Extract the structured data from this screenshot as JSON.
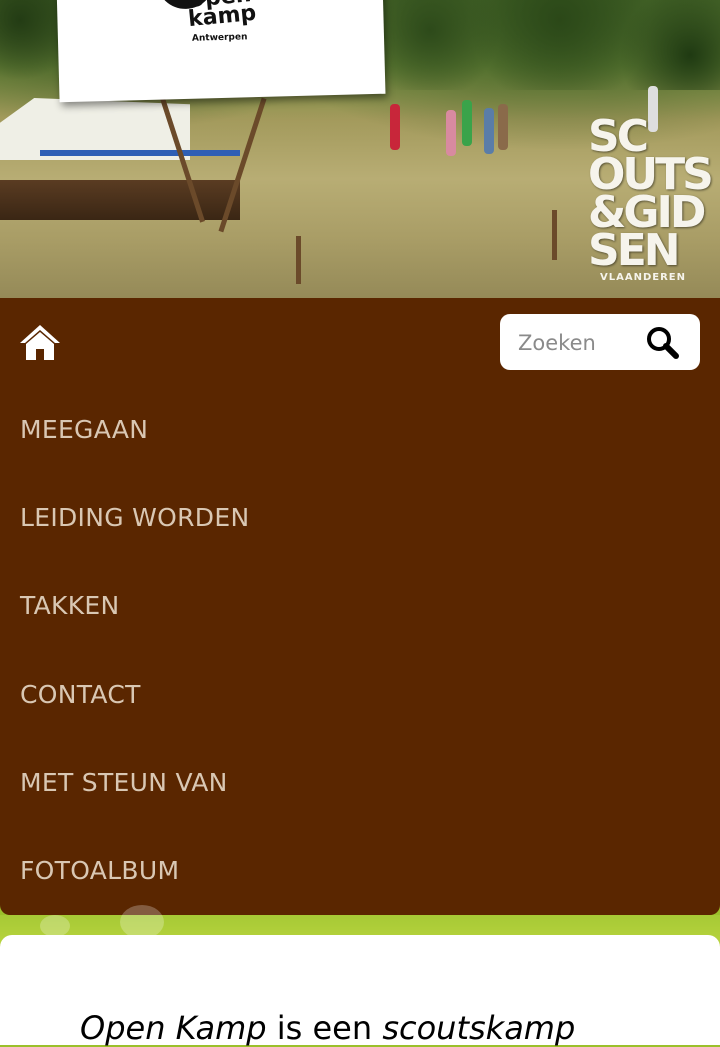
{
  "header": {
    "logo_line1": "Open",
    "logo_line2": "kamp",
    "logo_sub": "Antwerpen",
    "scouts_logo_lines": [
      "SC",
      "OUTS",
      "&GID",
      "SEN"
    ],
    "scouts_logo_sub": "VLAANDEREN"
  },
  "nav": {
    "home_icon": "home-icon",
    "search": {
      "placeholder": "Zoeken",
      "icon": "search-icon"
    },
    "items": [
      {
        "label": "MEEGAAN"
      },
      {
        "label": "LEIDING WORDEN"
      },
      {
        "label": "TAKKEN"
      },
      {
        "label": "CONTACT"
      },
      {
        "label": "MET STEUN VAN"
      },
      {
        "label": "FOTOALBUM"
      }
    ]
  },
  "content": {
    "intro_part1": "Open Kamp",
    "intro_part2": " is een ",
    "intro_part3": "scoutskamp"
  },
  "colors": {
    "nav_background": "#5a2600",
    "nav_text": "#d9c7b3",
    "page_background": "#9bc02b",
    "content_background": "#ffffff"
  }
}
